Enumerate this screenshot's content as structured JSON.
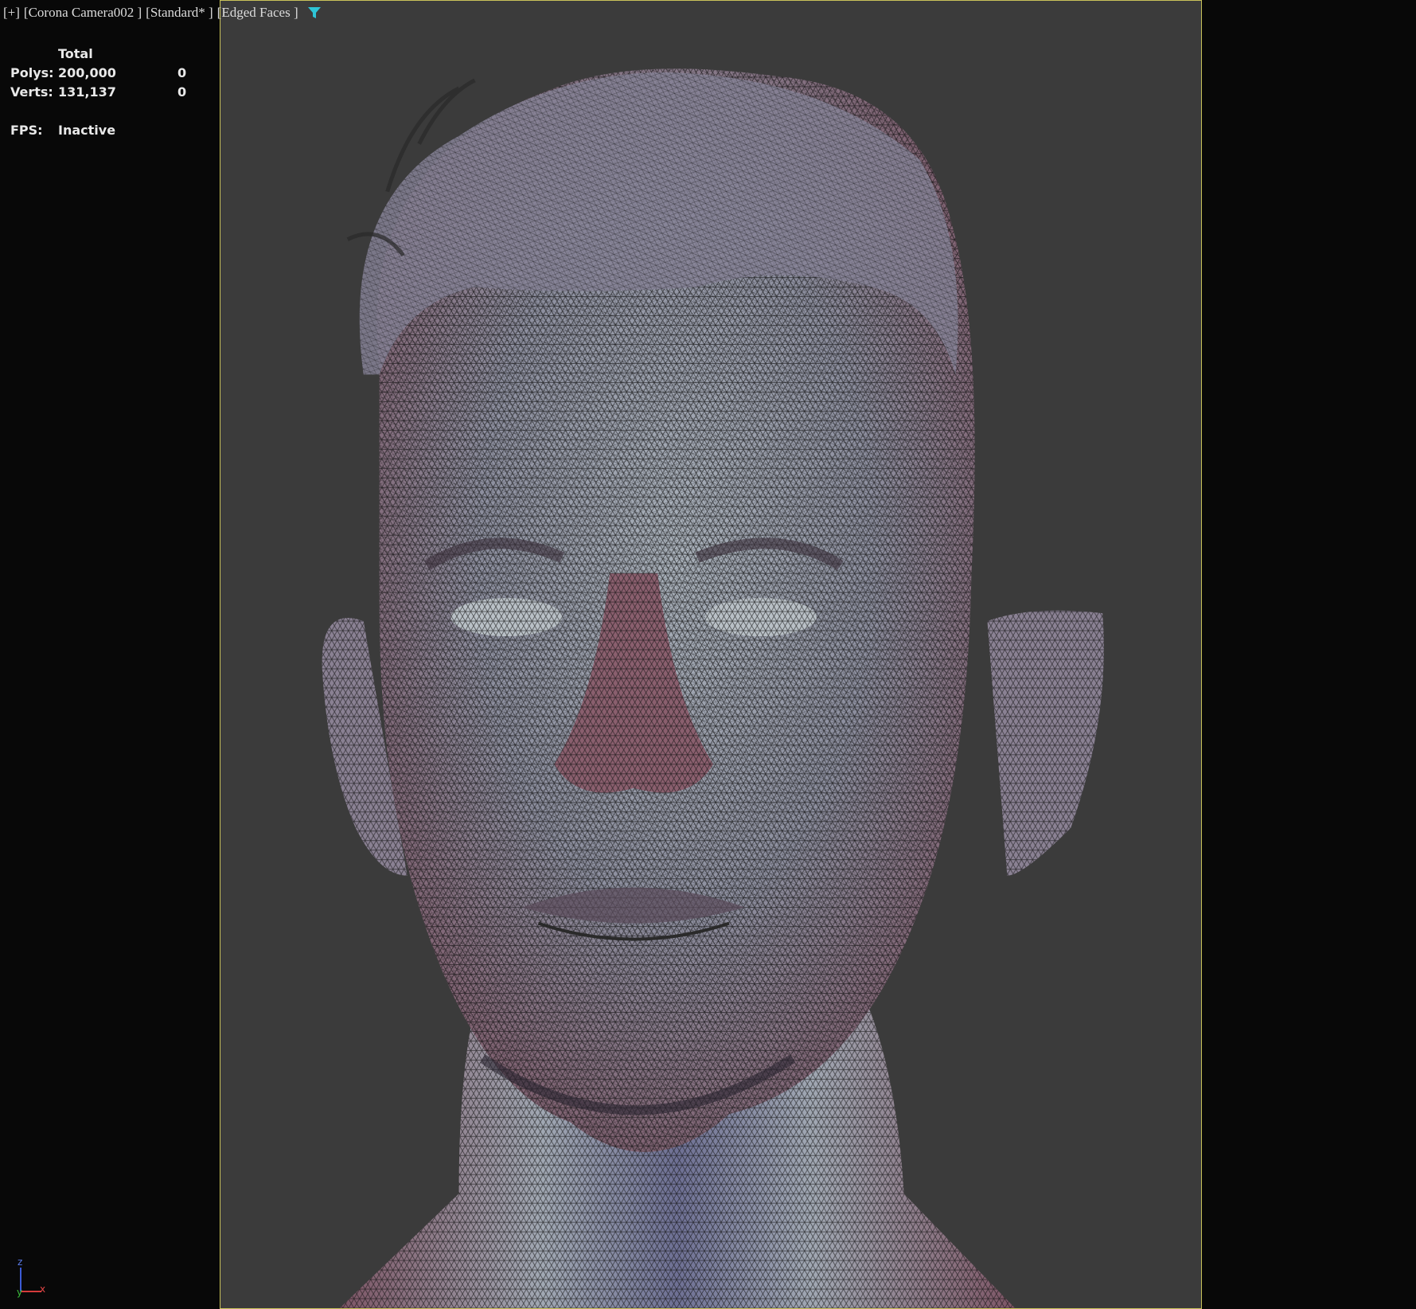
{
  "viewport": {
    "menu_label": "[+]",
    "camera_label": "[Corona Camera002 ]",
    "preset_label": "[Standard* ]",
    "shading_label": "[Edged Faces ]",
    "filter_icon": "filter-icon",
    "frame_color": "#c9c25a",
    "background_color": "#3b3b3b"
  },
  "stats": {
    "header": "Total",
    "polys_label": "Polys:",
    "polys_total": "200,000",
    "polys_selected": "0",
    "verts_label": "Verts:",
    "verts_total": "131,137",
    "verts_selected": "0",
    "fps_label": "FPS:",
    "fps_value": "Inactive"
  },
  "axis_gizmo": {
    "z": "z",
    "y": "y",
    "x": "x"
  }
}
